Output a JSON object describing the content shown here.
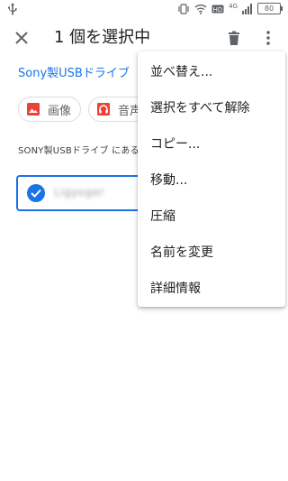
{
  "status_bar": {
    "network_type": "4G",
    "battery": "80",
    "icons": [
      "usb-icon",
      "vibrate-icon",
      "wifi-icon",
      "hd-icon",
      "signal-icon",
      "battery-icon"
    ]
  },
  "app_bar": {
    "title": "1 個を選択中",
    "close_icon": "close-icon",
    "delete_icon": "delete-icon",
    "more_icon": "more-vert-icon"
  },
  "breadcrumb": "Sony製USBドライブ",
  "chips": [
    {
      "label": "画像",
      "icon": "image-icon",
      "color": "#ea4335"
    },
    {
      "label": "音声",
      "icon": "headphones-icon",
      "color": "#ea4335"
    }
  ],
  "section_label": "SONY製USBドライブ にある",
  "file": {
    "name": "Ligyoger",
    "selected": true,
    "accent": "#1a73e8"
  },
  "menu": {
    "items": [
      {
        "label": "並べ替え..."
      },
      {
        "label": "選択をすべて解除"
      },
      {
        "label": "コピー..."
      },
      {
        "label": "移動..."
      },
      {
        "label": "圧縮"
      },
      {
        "label": "名前を変更"
      },
      {
        "label": "詳細情報"
      }
    ]
  }
}
